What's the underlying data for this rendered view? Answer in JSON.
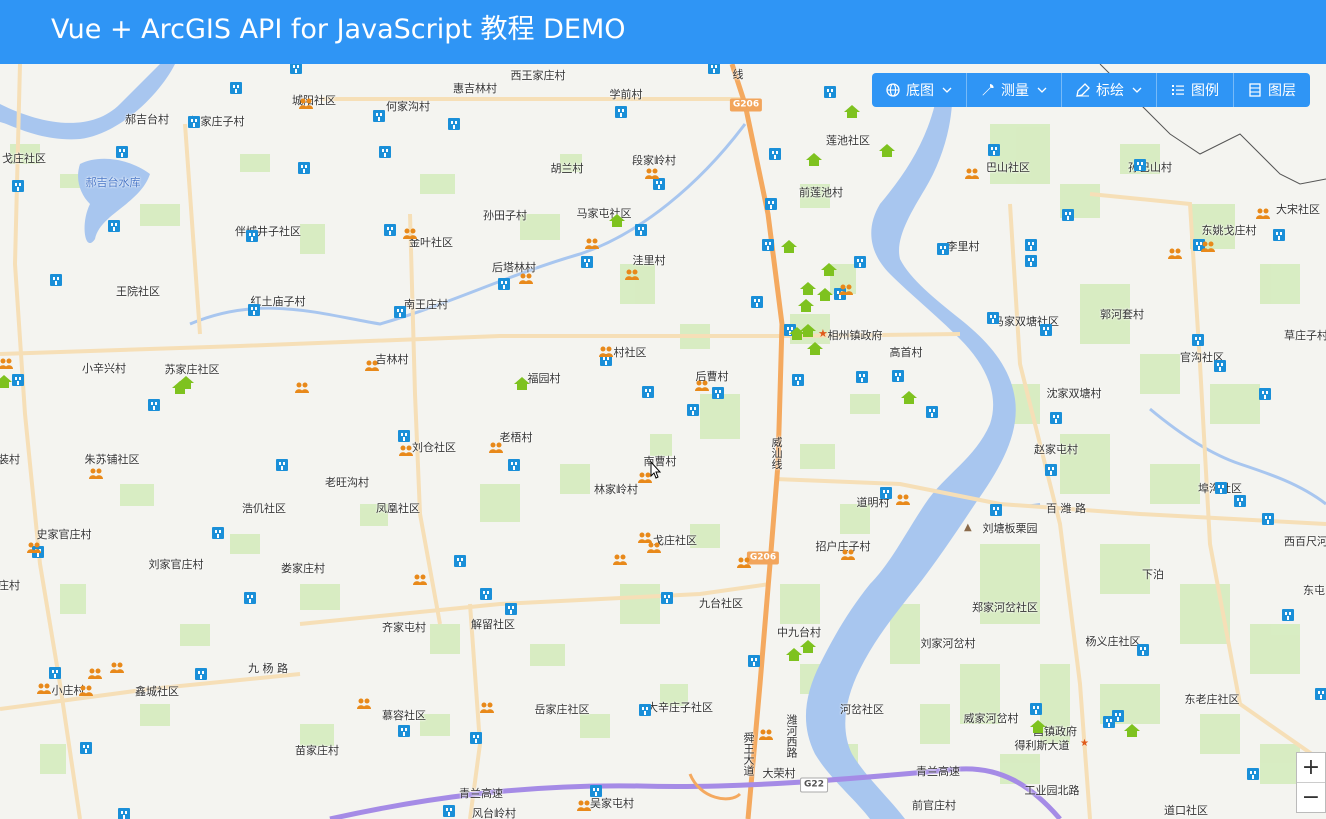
{
  "header": {
    "title": "Vue + ArcGIS API for JavaScript 教程 DEMO"
  },
  "toolbar": {
    "basemap": "底图",
    "measure": "测量",
    "mark": "标绘",
    "legend": "图例",
    "layers": "图层"
  },
  "zoom": {
    "in": "+",
    "out": "−"
  },
  "colors": {
    "header": "#2f95f5",
    "river": "#a8c6ef",
    "green": "#cfe9b4",
    "road_major": "#f4a95f",
    "road_minor": "#f6dfb7",
    "expressway": "#a58be6"
  },
  "place_labels": [
    [
      "西王家庄村"
    ],
    [
      "惠吉林村"
    ],
    [
      "何家沟村"
    ],
    [
      "城阳社区"
    ],
    [
      "学前村"
    ],
    [
      "赵家庄子村"
    ],
    [
      "郝吉台村"
    ],
    [
      "段家岭村"
    ],
    [
      "胡兰村"
    ],
    [
      "戈庄社区"
    ],
    [
      "孙田子村"
    ],
    [
      "马家屯社区"
    ],
    [
      "伴城井子社区"
    ],
    [
      "金叶社区"
    ],
    [
      "洼里村"
    ],
    [
      "后塔林村"
    ],
    [
      "王院社区"
    ],
    [
      "红土庙子村"
    ],
    [
      "南王庄村"
    ],
    [
      "小辛兴村"
    ],
    [
      "苏家庄社区"
    ],
    [
      "吉林村"
    ],
    [
      "村社区"
    ],
    [
      "福园村"
    ],
    [
      "后曹村"
    ],
    [
      "朱苏铺社区"
    ],
    [
      "刘仓社区"
    ],
    [
      "老梧村"
    ],
    [
      "老旺沟村"
    ],
    [
      "南曹村"
    ],
    [
      "林家岭村"
    ],
    [
      "浩仉社区"
    ],
    [
      "凤凰社区"
    ],
    [
      "史家官庄村"
    ],
    [
      "刘家官庄村"
    ],
    [
      "娄家庄村"
    ],
    [
      "戈庄社区"
    ],
    [
      "九台社区"
    ],
    [
      "齐家屯村"
    ],
    [
      "解留社区"
    ],
    [
      "鑫城社区"
    ],
    [
      "小庄村"
    ],
    [
      "慕容社区"
    ],
    [
      "岳家庄社区"
    ],
    [
      "大辛庄子社区"
    ],
    [
      "苗家庄村"
    ],
    [
      "风台岭村"
    ],
    [
      "吴家屯村"
    ],
    [
      "莲池社区"
    ],
    [
      "前莲池村"
    ],
    [
      "巴山社区"
    ],
    [
      "孙巴山村"
    ],
    [
      "大宋社区"
    ],
    [
      "东姚戈庄村"
    ],
    [
      "李里村"
    ],
    [
      "马家双塘社区"
    ],
    [
      "郭河套村"
    ],
    [
      "相州镇政府"
    ],
    [
      "高首村"
    ],
    [
      "官沟社区"
    ],
    [
      "草庄子村"
    ],
    [
      "沈家双塘村"
    ],
    [
      "赵家屯村"
    ],
    [
      "埠沟社区"
    ],
    [
      "道明村"
    ],
    [
      "刘塘板栗园"
    ],
    [
      "西百尺河"
    ],
    [
      "招户庄子村"
    ],
    [
      "下泊"
    ],
    [
      "东屯"
    ],
    [
      "中九台村"
    ],
    [
      "郑家河岔社区"
    ],
    [
      "刘家河岔村"
    ],
    [
      "杨义庄社区"
    ],
    [
      "河岔社区"
    ],
    [
      "东老庄社区"
    ],
    [
      "威家河岔村"
    ],
    [
      "昌镇政府"
    ],
    [
      "大荣村"
    ],
    [
      "前官庄村"
    ],
    [
      "道口社区"
    ],
    [
      "得利斯大道"
    ],
    [
      "工业园北路"
    ],
    [
      "装村"
    ],
    [
      "庄村"
    ]
  ],
  "road_labels": [
    "威汕线",
    "百 潍 路",
    "九 杨 路",
    "青兰高速",
    "青兰高速",
    "舜王大道",
    "潍河西路",
    "线"
  ],
  "water_labels": [
    "郝吉台水库"
  ],
  "route_shields": [
    "G206",
    "G206",
    "G22"
  ]
}
